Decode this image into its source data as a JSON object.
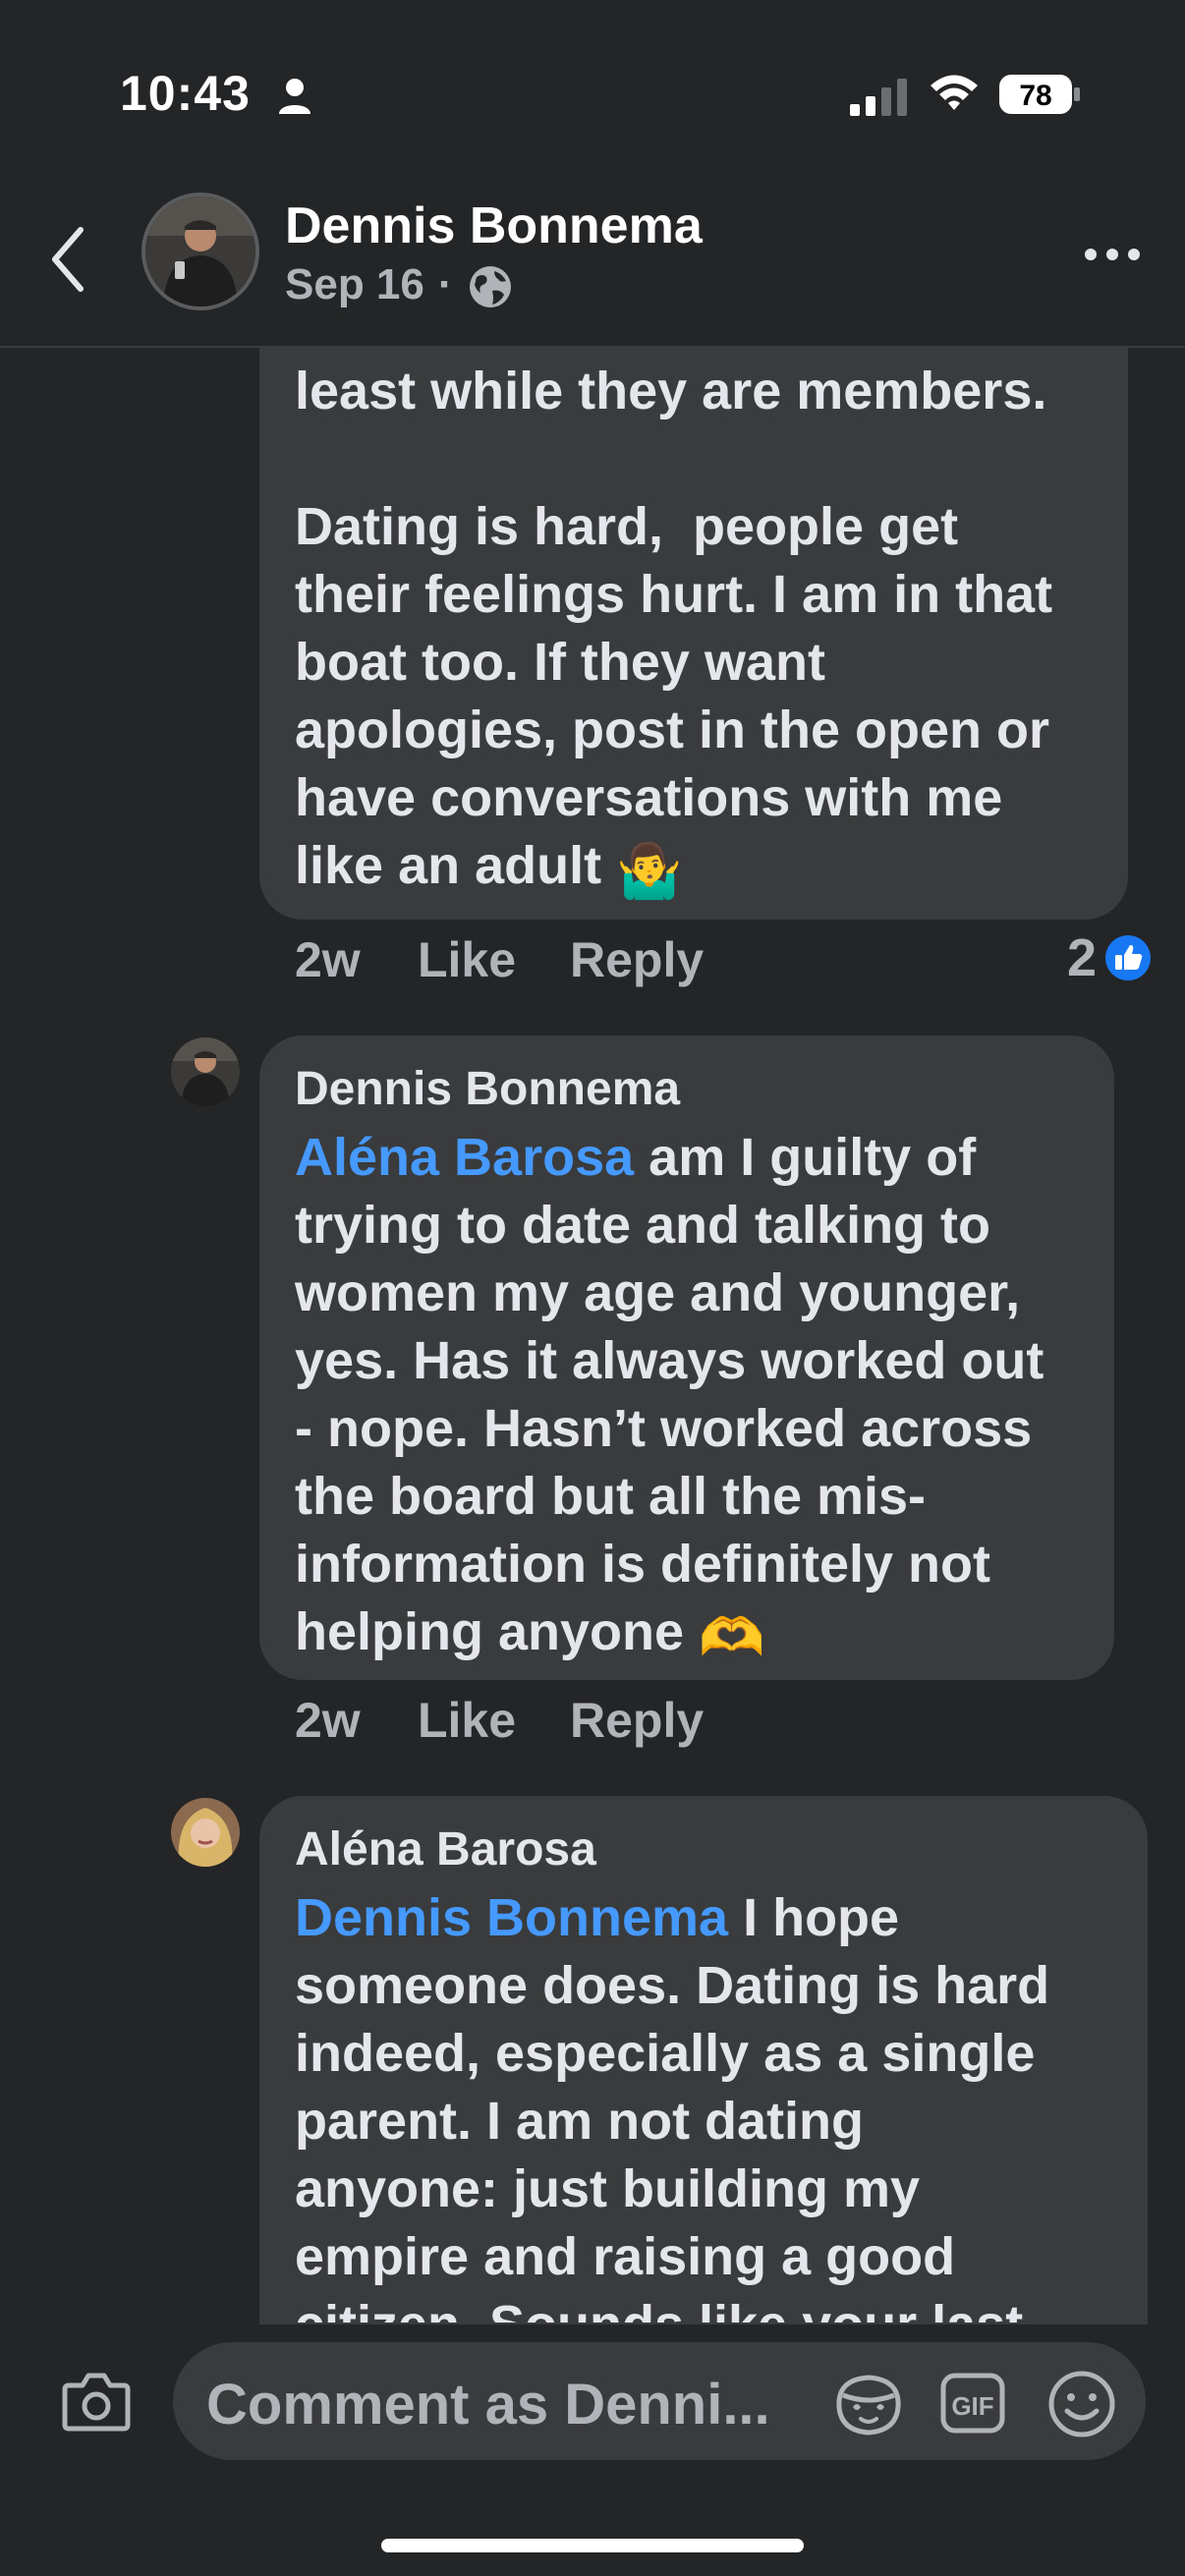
{
  "status_bar": {
    "time": "10:43",
    "battery": "78",
    "icons": [
      "person-icon",
      "signal-icon",
      "wifi-icon",
      "battery-icon"
    ]
  },
  "header": {
    "name": "Dennis Bonnema",
    "date": "Sep 16",
    "separator": "·",
    "icons": [
      "back-chevron-icon",
      "globe-icon",
      "more-icon"
    ]
  },
  "comments": [
    {
      "text_lines": [
        "least while they are members.",
        "",
        "Dating is hard,  people get",
        "their feelings hurt. I am in that",
        "boat too. If they want",
        "apologies, post in the open or",
        "have conversations with me",
        "like an adult"
      ],
      "emoji": "🤷‍♂️",
      "time": "2w",
      "like_label": "Like",
      "reply_label": "Reply",
      "reaction_count": "2"
    },
    {
      "author": "Dennis Bonnema",
      "mention": "Aléna Barosa",
      "first_line_rest": " am I guilty of",
      "text_lines": [
        "trying to date and talking to",
        "women my age and younger,",
        "yes. Has it always worked out",
        "- nope. Hasn’t worked across",
        "the board but all the mis-",
        "information is definitely not",
        "helping anyone"
      ],
      "emoji": "🫶",
      "time": "2w",
      "like_label": "Like",
      "reply_label": "Reply"
    },
    {
      "author": "Aléna Barosa",
      "mention": "Dennis Bonnema",
      "first_line_rest": " I hope",
      "text_lines": [
        "someone does. Dating is hard",
        "indeed, especially as a single",
        "parent. I am not dating",
        "anyone: just building my",
        "empire and raising a good",
        "citizen. Sounds like your last"
      ]
    }
  ],
  "composer": {
    "placeholder": "Comment as Denni...",
    "icons": [
      "camera-icon",
      "avatar-sticker-icon",
      "gif-icon",
      "emoji-icon"
    ],
    "gif_label": "GIF"
  },
  "colors": {
    "background": "#242526",
    "bubble": "#3a3b3c",
    "mention": "#4599ff",
    "secondary_text": "#b0b3b8",
    "like_blue": "#1877f2"
  }
}
